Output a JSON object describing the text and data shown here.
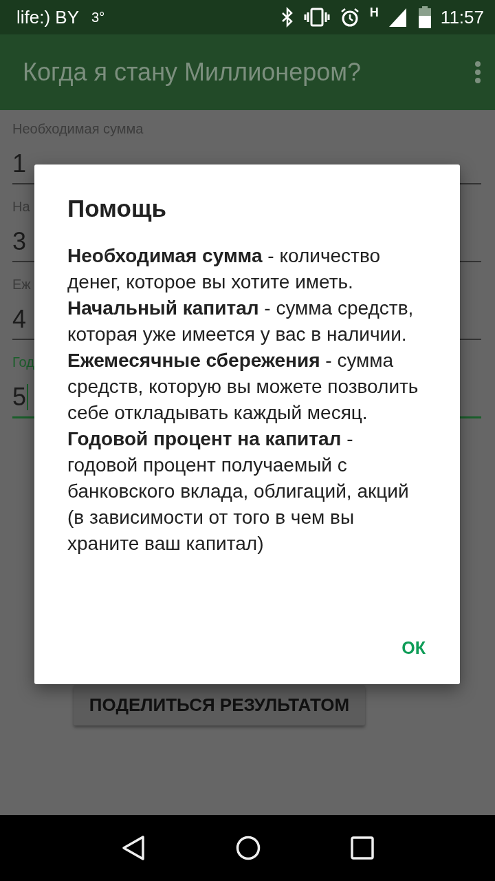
{
  "status_bar": {
    "carrier": "life:) BY",
    "temperature": "3°",
    "network": "H",
    "time": "11:57"
  },
  "app_bar": {
    "title": "Когда я стану Миллионером?"
  },
  "fields": [
    {
      "label": "Необходимая сумма",
      "value": "1",
      "focused": false
    },
    {
      "label": "На",
      "value": "3",
      "focused": false
    },
    {
      "label": "Еж",
      "value": "4",
      "focused": false
    },
    {
      "label": "Год",
      "value": "5",
      "focused": true
    }
  ],
  "share_button": "ПОДЕЛИТЬСЯ РЕЗУЛЬТАТОМ",
  "dialog": {
    "title": "Помощь",
    "paragraphs": [
      "**Необходимая сумма** - количество денег, которое вы хотите иметь.",
      "**Начальный капитал** - сумма средств, которая уже имеется у вас в наличии.",
      "**Ежемесячные сбережения** - сумма средств, которую вы можете позволить себе откладывать каждый месяц.",
      "**Годовой процент на капитал** - годовой процент получаемый с банковского вклада, облигаций, акций (в зависимости от того в чем вы храните ваш капитал)"
    ],
    "button": "ОК"
  }
}
